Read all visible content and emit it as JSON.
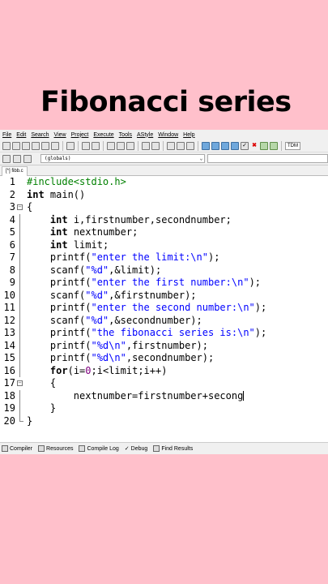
{
  "title": "Fibonacci series",
  "menu": [
    "File",
    "Edit",
    "Search",
    "View",
    "Project",
    "Execute",
    "Tools",
    "AStyle",
    "Window",
    "Help"
  ],
  "toolbar": {
    "scope_select": "(globals)",
    "compiler_label": "TDM"
  },
  "tab": {
    "label": "[*] fibb.c"
  },
  "lines": [
    {
      "n": "1",
      "parts": [
        {
          "t": "#include<stdio.h>",
          "c": "pp"
        }
      ]
    },
    {
      "n": "2",
      "parts": [
        {
          "t": "int",
          "c": "kw"
        },
        {
          "t": " main()",
          "c": ""
        }
      ]
    },
    {
      "n": "3",
      "parts": [
        {
          "t": "{",
          "c": ""
        }
      ]
    },
    {
      "n": "4",
      "parts": [
        {
          "t": "    ",
          "c": ""
        },
        {
          "t": "int",
          "c": "kw"
        },
        {
          "t": " i,firstnumber,secondnumber;",
          "c": ""
        }
      ]
    },
    {
      "n": "5",
      "parts": [
        {
          "t": "    ",
          "c": ""
        },
        {
          "t": "int",
          "c": "kw"
        },
        {
          "t": " nextnumber;",
          "c": ""
        }
      ]
    },
    {
      "n": "6",
      "parts": [
        {
          "t": "    ",
          "c": ""
        },
        {
          "t": "int",
          "c": "kw"
        },
        {
          "t": " limit;",
          "c": ""
        }
      ]
    },
    {
      "n": "7",
      "parts": [
        {
          "t": "    printf(",
          "c": ""
        },
        {
          "t": "\"enter the limit:\\n\"",
          "c": "str"
        },
        {
          "t": ");",
          "c": ""
        }
      ]
    },
    {
      "n": "8",
      "parts": [
        {
          "t": "    scanf(",
          "c": ""
        },
        {
          "t": "\"%d\"",
          "c": "str"
        },
        {
          "t": ",&limit);",
          "c": ""
        }
      ]
    },
    {
      "n": "9",
      "parts": [
        {
          "t": "    printf(",
          "c": ""
        },
        {
          "t": "\"enter the first number:\\n\"",
          "c": "str"
        },
        {
          "t": ");",
          "c": ""
        }
      ]
    },
    {
      "n": "10",
      "parts": [
        {
          "t": "    scanf(",
          "c": ""
        },
        {
          "t": "\"%d\"",
          "c": "str"
        },
        {
          "t": ",&firstnumber);",
          "c": ""
        }
      ]
    },
    {
      "n": "11",
      "parts": [
        {
          "t": "    printf(",
          "c": ""
        },
        {
          "t": "\"enter the second number:\\n\"",
          "c": "str"
        },
        {
          "t": ");",
          "c": ""
        }
      ]
    },
    {
      "n": "12",
      "parts": [
        {
          "t": "    scanf(",
          "c": ""
        },
        {
          "t": "\"%d\"",
          "c": "str"
        },
        {
          "t": ",&secondnumber);",
          "c": ""
        }
      ]
    },
    {
      "n": "13",
      "parts": [
        {
          "t": "    printf(",
          "c": ""
        },
        {
          "t": "\"the fibonacci series is:\\n\"",
          "c": "str"
        },
        {
          "t": ");",
          "c": ""
        }
      ]
    },
    {
      "n": "14",
      "parts": [
        {
          "t": "    printf(",
          "c": ""
        },
        {
          "t": "\"%d\\n\"",
          "c": "str"
        },
        {
          "t": ",firstnumber);",
          "c": ""
        }
      ]
    },
    {
      "n": "15",
      "parts": [
        {
          "t": "    printf(",
          "c": ""
        },
        {
          "t": "\"%d\\n\"",
          "c": "str"
        },
        {
          "t": ",secondnumber);",
          "c": ""
        }
      ]
    },
    {
      "n": "16",
      "parts": [
        {
          "t": "    ",
          "c": ""
        },
        {
          "t": "for",
          "c": "kw"
        },
        {
          "t": "(i=",
          "c": ""
        },
        {
          "t": "0",
          "c": "num"
        },
        {
          "t": ";i<limit;i++)",
          "c": ""
        }
      ]
    },
    {
      "n": "17",
      "parts": [
        {
          "t": "    {",
          "c": ""
        }
      ]
    },
    {
      "n": "18",
      "parts": [
        {
          "t": "        nextnumber=firstnumber+secong",
          "c": ""
        }
      ]
    },
    {
      "n": "19",
      "parts": [
        {
          "t": "    }",
          "c": ""
        }
      ]
    },
    {
      "n": "20",
      "parts": [
        {
          "t": "}",
          "c": ""
        }
      ]
    }
  ],
  "fold_markers": {
    "3": "open",
    "17": "open",
    "20": "end"
  },
  "status": {
    "compiler": "Compiler",
    "resources": "Resources",
    "compile_log": "Compile Log",
    "debug": "Debug",
    "find_results": "Find Results"
  }
}
